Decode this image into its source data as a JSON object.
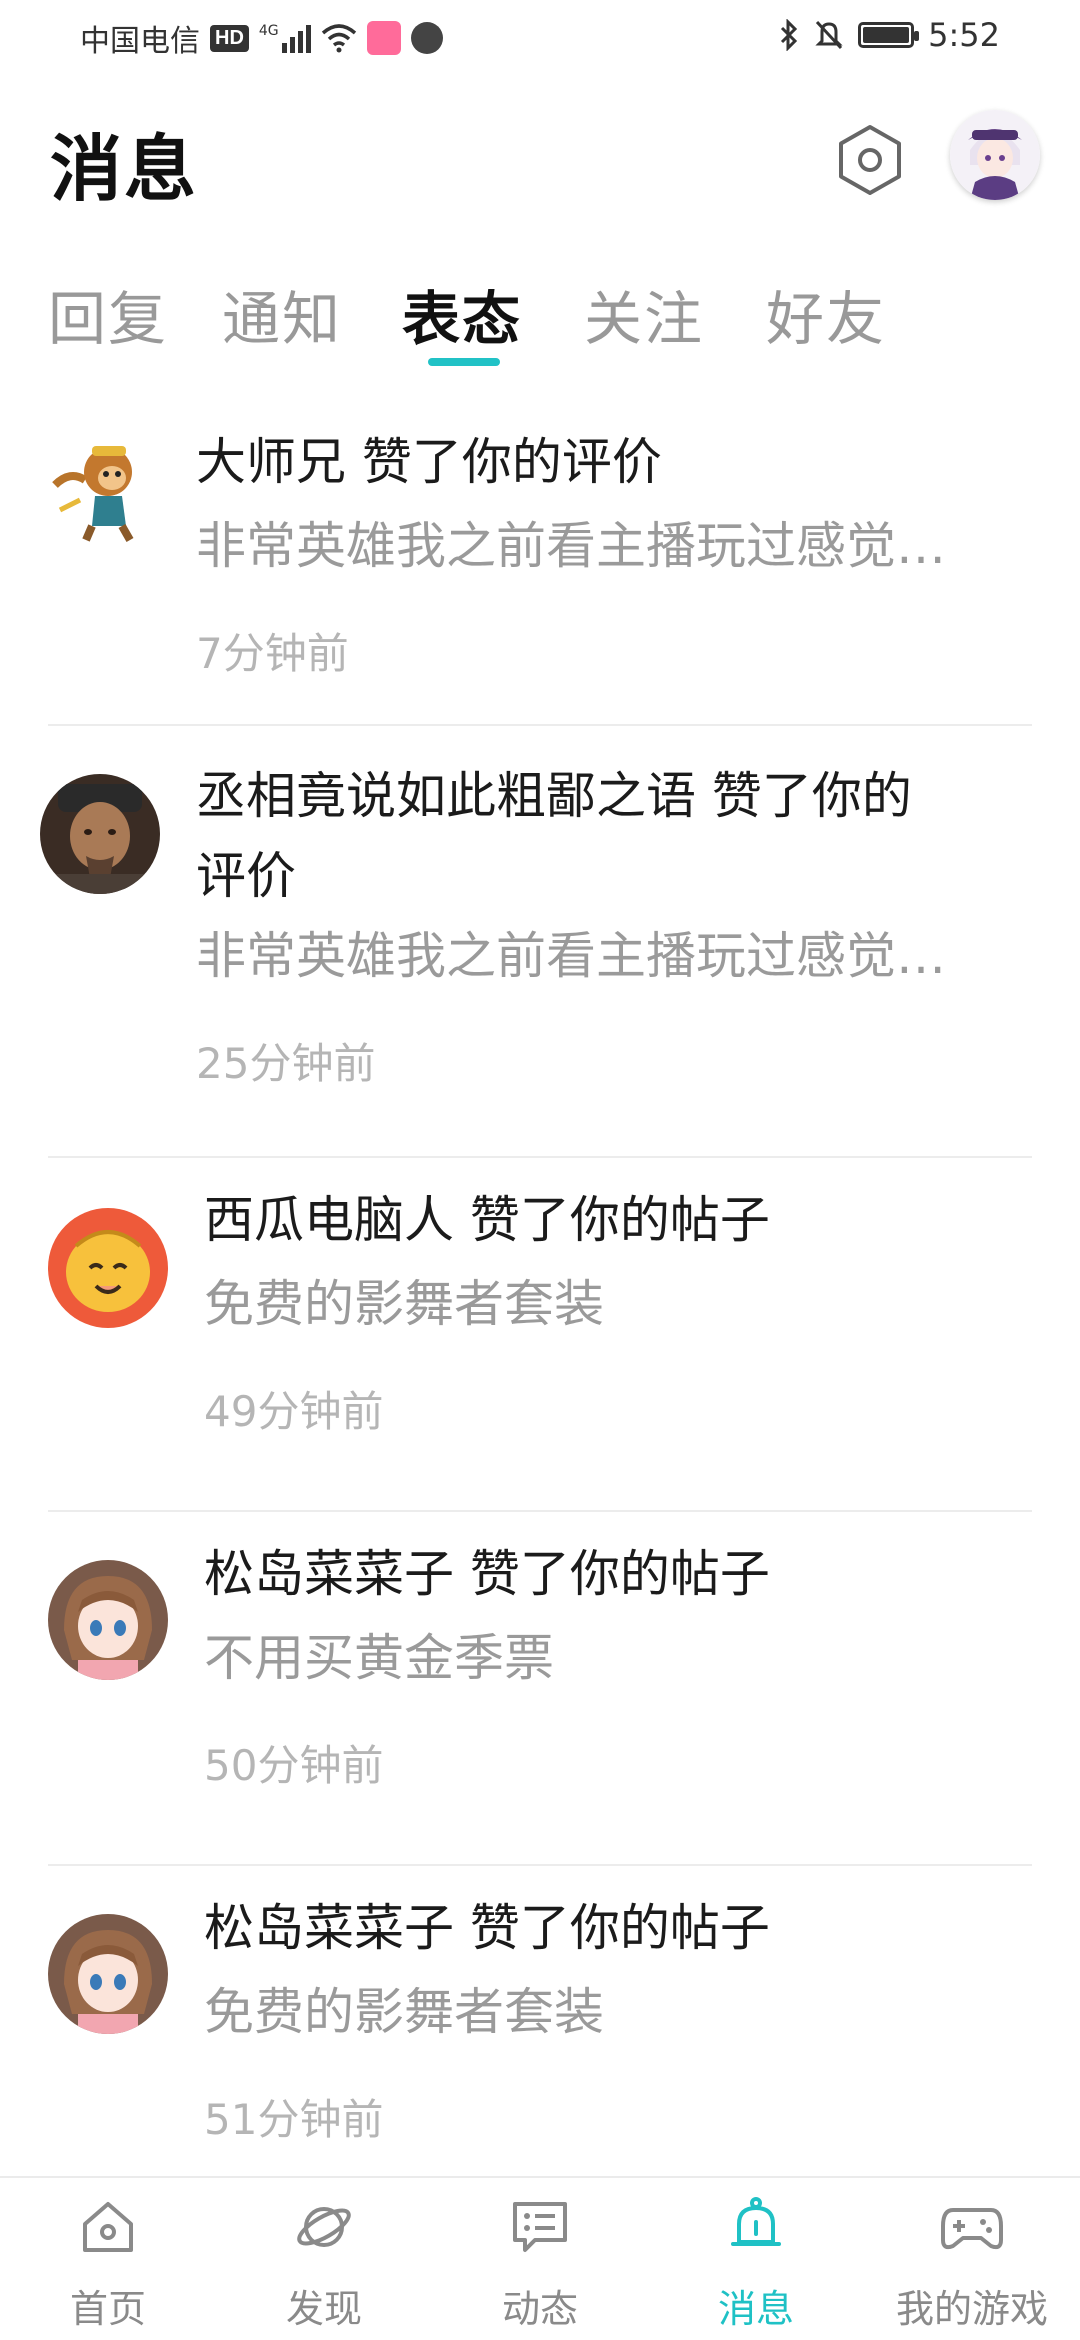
{
  "status_bar": {
    "carrier": "中国电信",
    "hd": "HD",
    "network": "4G",
    "time": "5:52"
  },
  "header": {
    "title": "消息"
  },
  "tabs": [
    {
      "label": "回复",
      "active": false
    },
    {
      "label": "通知",
      "active": false
    },
    {
      "label": "表态",
      "active": true
    },
    {
      "label": "关注",
      "active": false
    },
    {
      "label": "好友",
      "active": false
    }
  ],
  "messages": [
    {
      "user": "大师兄",
      "action": "赞了你的评价",
      "title": "大师兄 赞了你的评价",
      "body": "非常英雄我之前看主播玩过感觉…",
      "time": "7分钟前",
      "avatar": "monkey-king-avatar"
    },
    {
      "user": "丞相竟说如此粗鄙之语",
      "action": "赞了你的评价",
      "title_line1": "丞相竟说如此粗鄙之语 赞了你的",
      "title_line2": "评价",
      "body": "非常英雄我之前看主播玩过感觉…",
      "time": "25分钟前",
      "avatar": "man-avatar"
    },
    {
      "user": "西瓜电脑人",
      "action": "赞了你的帖子",
      "title": "西瓜电脑人 赞了你的帖子",
      "body": "免费的影舞者套装",
      "time": "49分钟前",
      "avatar": "cartoon-face-avatar"
    },
    {
      "user": "松岛菜菜子",
      "action": "赞了你的帖子",
      "title": "松岛菜菜子 赞了你的帖子",
      "body": "不用买黄金季票",
      "time": "50分钟前",
      "avatar": "anime-girl-avatar"
    },
    {
      "user": "松岛菜菜子",
      "action": "赞了你的帖子",
      "title": "松岛菜菜子 赞了你的帖子",
      "body": "免费的影舞者套装",
      "time": "51分钟前",
      "avatar": "anime-girl-avatar"
    }
  ],
  "bottom_nav": [
    {
      "label": "首页",
      "icon": "home-icon",
      "active": false
    },
    {
      "label": "发现",
      "icon": "planet-icon",
      "active": false
    },
    {
      "label": "动态",
      "icon": "chat-icon",
      "active": false
    },
    {
      "label": "消息",
      "icon": "bell-icon",
      "active": true
    },
    {
      "label": "我的游戏",
      "icon": "gamepad-icon",
      "active": false
    }
  ],
  "colors": {
    "accent": "#21c2c6",
    "text_primary": "#1b1b1b",
    "text_secondary": "#9a9a9a",
    "text_time": "#b5b5b5"
  }
}
